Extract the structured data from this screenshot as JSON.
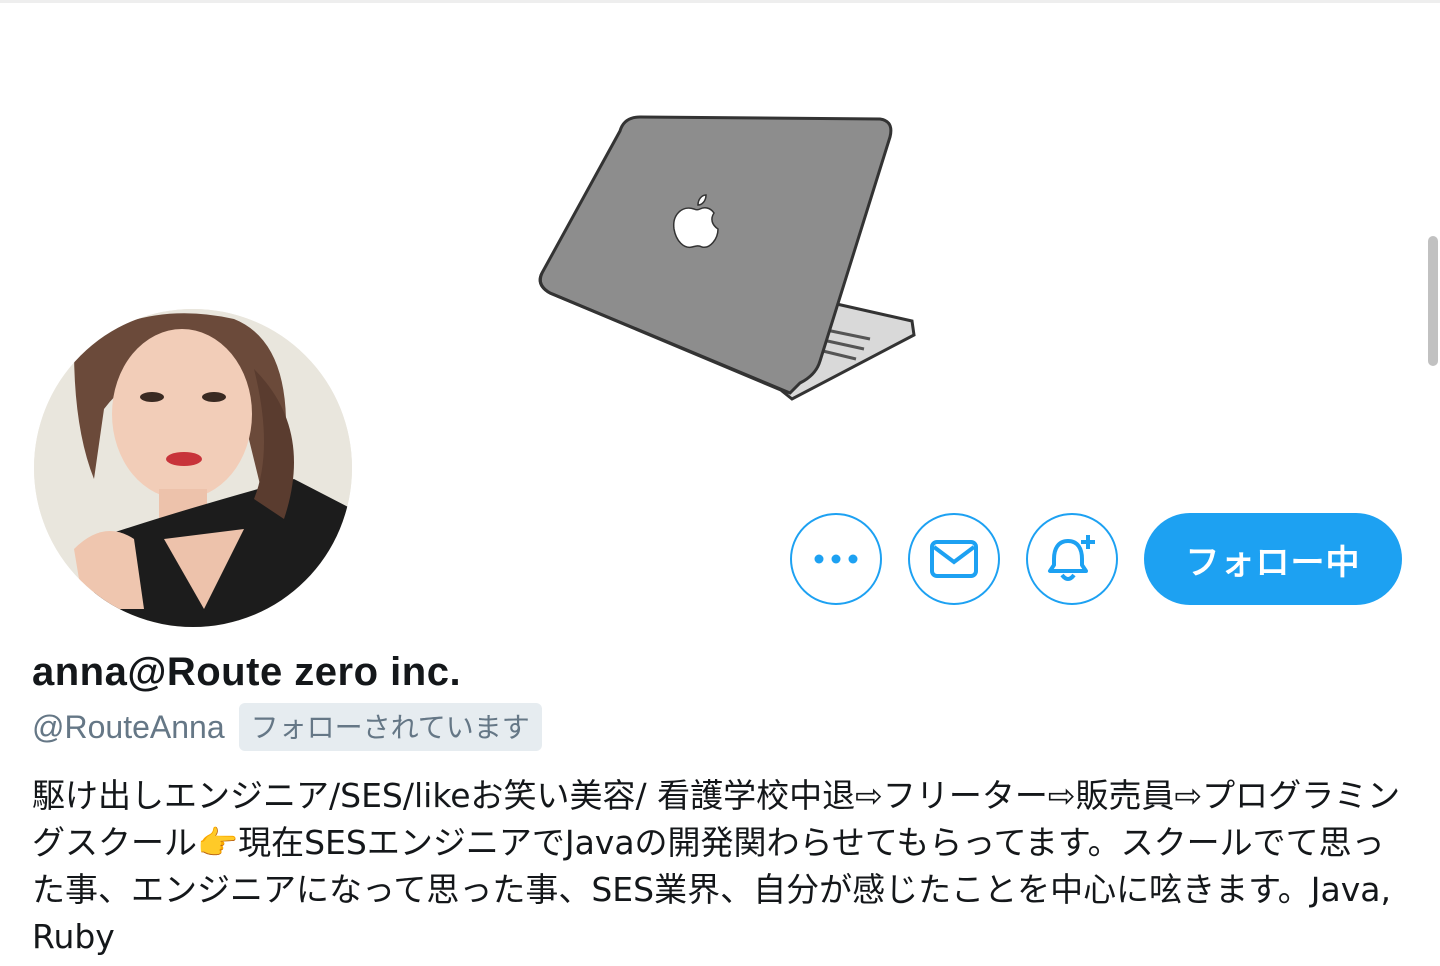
{
  "profile": {
    "display_name": "anna@Route zero inc.",
    "handle": "@RouteAnna",
    "follows_you_badge": "フォローされています",
    "bio": "駆け出しエンジニア/SES/likeお笑い美容/ 看護学校中退⇨フリーター⇨販売員⇨プログラミングスクール👉現在SESエンジニアでJavaの開発関わらせてもらってます。スクールでて思った事、エンジニアになって思った事、SES業界、自分が感じたことを中心に呟きます。Java,Ruby"
  },
  "actions": {
    "follow_button_label": "フォロー中",
    "more_icon": "more-icon",
    "message_icon": "envelope-icon",
    "notify_icon": "bell-plus-icon"
  },
  "colors": {
    "accent": "#1da1f2",
    "text_primary": "#14171a",
    "text_secondary": "#657786",
    "badge_bg": "#e6ecf0"
  }
}
